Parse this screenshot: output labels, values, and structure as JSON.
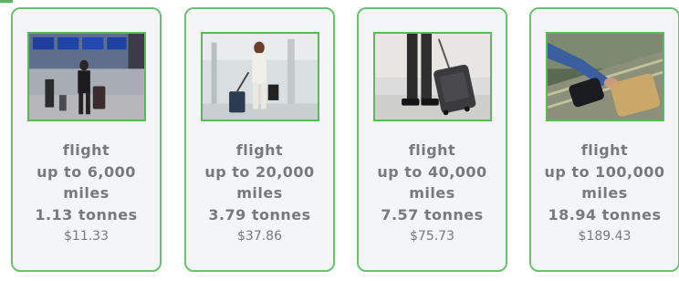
{
  "cards": [
    {
      "mode": "flight",
      "distance": "up to 6,000",
      "unit": "miles",
      "carbon": "1.13 tonnes",
      "price": "$11.33",
      "image": "airport-terminal-photo"
    },
    {
      "mode": "flight",
      "distance": "up to 20,000",
      "unit": "miles",
      "carbon": "3.79 tonnes",
      "price": "$37.86",
      "image": "businesswoman-with-luggage-photo"
    },
    {
      "mode": "flight",
      "distance": "up to 40,000",
      "unit": "miles",
      "carbon": "7.57 tonnes",
      "price": "$75.73",
      "image": "rolling-suitcase-photo"
    },
    {
      "mode": "flight",
      "distance": "up to 100,000",
      "unit": "miles",
      "carbon": "18.94 tonnes",
      "price": "$189.43",
      "image": "baggage-carousel-photo"
    }
  ],
  "colors": {
    "border": "#6cc070",
    "photo_border": "#5cb85c",
    "card_bg": "#f4f5f7",
    "text": "#777a7d"
  }
}
